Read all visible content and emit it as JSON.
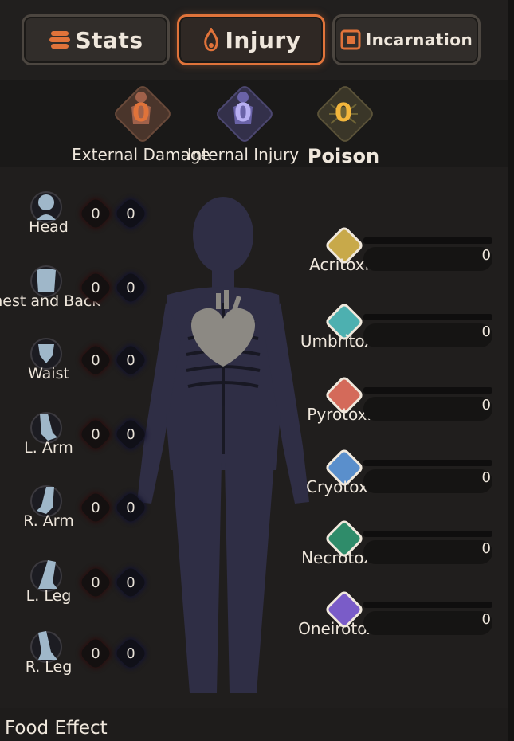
{
  "tabs": [
    {
      "label": "Stats",
      "icon": "stack-icon"
    },
    {
      "label": "Injury",
      "icon": "flame-icon",
      "active": true
    },
    {
      "label": "Incarnation",
      "icon": "incarnation-icon"
    }
  ],
  "summary": [
    {
      "label": "External Damage",
      "value": "0",
      "color": "#e0733a"
    },
    {
      "label": "Internal Injury",
      "value": "0",
      "color": "#b8aff2"
    },
    {
      "label": "Poison",
      "value": "0",
      "color": "#f2b63c"
    }
  ],
  "body_parts": [
    {
      "label": "Head",
      "external": "0",
      "internal": "0",
      "icon": "head-icon"
    },
    {
      "label": "Chest and Back",
      "external": "0",
      "internal": "0",
      "icon": "chest-icon"
    },
    {
      "label": "Waist",
      "external": "0",
      "internal": "0",
      "icon": "waist-icon"
    },
    {
      "label": "L. Arm",
      "external": "0",
      "internal": "0",
      "icon": "left-arm-icon"
    },
    {
      "label": "R. Arm",
      "external": "0",
      "internal": "0",
      "icon": "right-arm-icon"
    },
    {
      "label": "L. Leg",
      "external": "0",
      "internal": "0",
      "icon": "left-leg-icon"
    },
    {
      "label": "R. Leg",
      "external": "0",
      "internal": "0",
      "icon": "right-leg-icon"
    }
  ],
  "poisons": [
    {
      "label": "Acritoxin",
      "value": "0",
      "color": "#c8a94a",
      "icon": "acritoxin-icon"
    },
    {
      "label": "Umbritoxin",
      "value": "0",
      "color": "#4db0b0",
      "icon": "umbritoxin-icon"
    },
    {
      "label": "Pyrotoxin",
      "value": "0",
      "color": "#d46a5a",
      "icon": "pyrotoxin-icon"
    },
    {
      "label": "Cryotoxin",
      "value": "0",
      "color": "#5a8fcc",
      "icon": "cryotoxin-icon"
    },
    {
      "label": "Necrotoxin",
      "value": "0",
      "color": "#2f8c6a",
      "icon": "necrotoxin-icon"
    },
    {
      "label": "Oneirotoxin",
      "value": "0",
      "color": "#7a5cc8",
      "icon": "oneirotoxin-icon"
    }
  ],
  "footer": {
    "label": "Food Effect"
  }
}
